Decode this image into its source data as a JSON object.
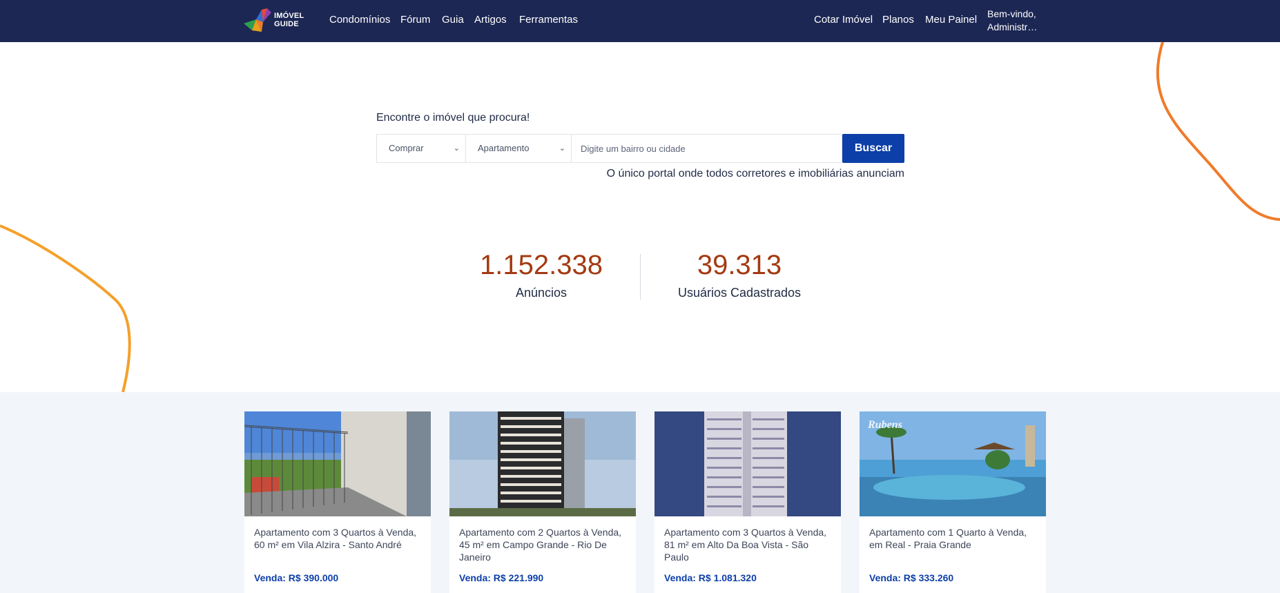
{
  "brand": {
    "line1": "IMÓVEL",
    "line2": "GUIDE"
  },
  "nav": {
    "left": [
      "Condomínios",
      "Fórum",
      "Guia",
      "Artigos",
      "Ferramentas"
    ],
    "right": [
      "Cotar Imóvel",
      "Planos",
      "Meu Painel"
    ],
    "welcome_line1": "Bem-vindo,",
    "welcome_line2": "Administrador"
  },
  "search": {
    "title": "Encontre o imóvel que procura!",
    "transaction_selected": "Comprar",
    "type_selected": "Apartamento",
    "placeholder": "Digite um bairro ou cidade",
    "button": "Buscar",
    "tagline": "O único portal onde todos corretores e imobiliárias anunciam"
  },
  "stats": [
    {
      "value": "1.152.338",
      "label": "Anúncios"
    },
    {
      "value": "39.313",
      "label": "Usuários Cadastrados"
    }
  ],
  "listings": [
    {
      "title": "Apartamento com 3 Quartos à Venda, 60 m² em Vila Alzira - Santo André",
      "price": "Venda: R$ 390.000"
    },
    {
      "title": "Apartamento com 2 Quartos à Venda, 45 m² em Campo Grande - Rio De Janeiro",
      "price": "Venda: R$ 221.990"
    },
    {
      "title": "Apartamento com 3 Quartos à Venda, 81 m² em Alto Da Boa Vista - São Paulo",
      "price": "Venda: R$ 1.081.320"
    },
    {
      "title": "Apartamento com 1 Quarto à Venda, em Real - Praia Grande",
      "price": "Venda: R$ 333.260",
      "image_watermark": "Rubens"
    }
  ],
  "colors": {
    "navbar": "#1c2753",
    "accent_blue": "#0d3fa8",
    "stat_orange": "#a33a12",
    "deco_orange": "#f4a02a",
    "listing_bg": "#f2f6fb"
  },
  "icons": [
    "chevron-down-icon",
    "brand-logo-icon"
  ]
}
